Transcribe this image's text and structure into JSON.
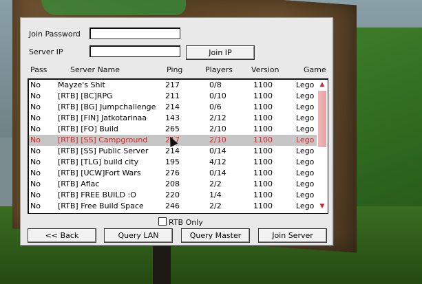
{
  "form": {
    "join_password_label": "Join Password",
    "join_password_value": "",
    "server_ip_label": "Server IP",
    "server_ip_value": "",
    "join_ip_button": "Join IP"
  },
  "columns": {
    "pass": "Pass",
    "name": "Server Name",
    "ping": "Ping",
    "players": "Players",
    "version": "Version",
    "game": "Game"
  },
  "servers": [
    {
      "pass": "No",
      "name": "  Mayze's Shit",
      "ping": "217",
      "players": "0/8",
      "version": "1100",
      "game": "Lego"
    },
    {
      "pass": "No",
      "name": "[RTB] [BC]RPG",
      "ping": "211",
      "players": "0/10",
      "version": "1100",
      "game": "Lego"
    },
    {
      "pass": "No",
      "name": "[RTB] [BG] Jumpchallenge",
      "ping": "214",
      "players": "0/6",
      "version": "1100",
      "game": "Lego"
    },
    {
      "pass": "No",
      "name": "[RTB] [FIN] Jatkotarinaa",
      "ping": "143",
      "players": "2/12",
      "version": "1100",
      "game": "Lego"
    },
    {
      "pass": "No",
      "name": "[RTB] [FO] Build",
      "ping": "265",
      "players": "2/10",
      "version": "1100",
      "game": "Lego"
    },
    {
      "pass": "No",
      "name": "[RTB] [SS] Campground",
      "ping": "217",
      "players": "2/10",
      "version": "1100",
      "game": "Lego",
      "selected": true
    },
    {
      "pass": "No",
      "name": "[RTB] [SS] Public Server",
      "ping": "214",
      "players": "0/14",
      "version": "1100",
      "game": "Lego"
    },
    {
      "pass": "No",
      "name": "[RTB] [TLG] build city",
      "ping": "195",
      "players": "4/12",
      "version": "1100",
      "game": "Lego"
    },
    {
      "pass": "No",
      "name": "[RTB] [UCW]Fort Wars",
      "ping": "276",
      "players": "0/14",
      "version": "1100",
      "game": "Lego"
    },
    {
      "pass": "No",
      "name": "[RTB] Aflac",
      "ping": "208",
      "players": "2/2",
      "version": "1100",
      "game": "Lego"
    },
    {
      "pass": "No",
      "name": "[RTB] FREE BUILD :O",
      "ping": "220",
      "players": "1/4",
      "version": "1100",
      "game": "Lego"
    },
    {
      "pass": "No",
      "name": "[RTB] Free Build Space",
      "ping": "246",
      "players": "2/2",
      "version": "1100",
      "game": "Lego"
    }
  ],
  "rtb_only_label": "RTB Only",
  "rtb_only_checked": false,
  "buttons": {
    "back": "<< Back",
    "query_lan": "Query LAN",
    "query_master": "Query Master",
    "join_server": "Join Server"
  },
  "icons": {
    "scroll_up": "scroll-up-arrow-icon",
    "scroll_down": "scroll-down-arrow-icon",
    "cursor": "mouse-pointer-icon"
  },
  "colors": {
    "selected_text": "#e02020",
    "selected_row": "#c6c6c6",
    "scroll_thumb": "#e8a0a0"
  }
}
